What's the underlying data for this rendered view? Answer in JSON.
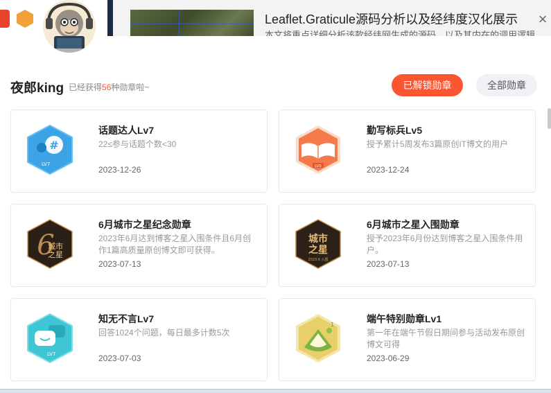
{
  "background": {
    "article_title": "Leaflet.Graticule源码分析以及经纬度汉化展示",
    "article_desc": "本文将重点详细分析该款经纬网生成的源码，以及其内在的调用逻辑"
  },
  "modal": {
    "close_label": "×",
    "user_name": "夜郎king",
    "badge_prefix": "已经获得",
    "badge_count": "56",
    "badge_suffix": "种勋章啦~",
    "btn_unlocked": "已解锁勋章",
    "btn_all": "全部勋章",
    "colors": {
      "accent": "#fc5531"
    }
  },
  "badges": [
    {
      "name": "话题达人Lv7",
      "desc": "22≤参与话题个数<30",
      "date": "2023-12-26",
      "icon": "topic-talent-icon"
    },
    {
      "name": "勤写标兵Lv5",
      "desc": "授予累计5周发布3篇原创IT博文的用户",
      "date": "2023-12-24",
      "icon": "diligent-writer-icon"
    },
    {
      "name": "6月城市之星纪念勋章",
      "desc": "2023年6月达到博客之星入围条件且6月创作1篇高质量原创博文即可获得。",
      "date": "2023-07-13",
      "icon": "city-star-memorial-icon"
    },
    {
      "name": "6月城市之星入围勋章",
      "desc": "授予2023年6月份达到博客之星入围条件用户。",
      "date": "2023-07-13",
      "icon": "city-star-finalist-icon"
    },
    {
      "name": "知无不言Lv7",
      "desc": "回答1024个问题，每日最多计数5次",
      "date": "2023-07-03",
      "icon": "answer-all-icon"
    },
    {
      "name": "端午特别勋章Lv1",
      "desc": "第一年在端午节假日期间参与活动发布原创博文可得",
      "date": "2023-06-29",
      "icon": "dragon-boat-icon"
    }
  ],
  "icon_labels": {
    "lv7": "LV7",
    "lv5": "LV5",
    "city_line1": "城市",
    "city_line2": "之星",
    "city_sub": "2023.6 入围",
    "six": "6"
  }
}
